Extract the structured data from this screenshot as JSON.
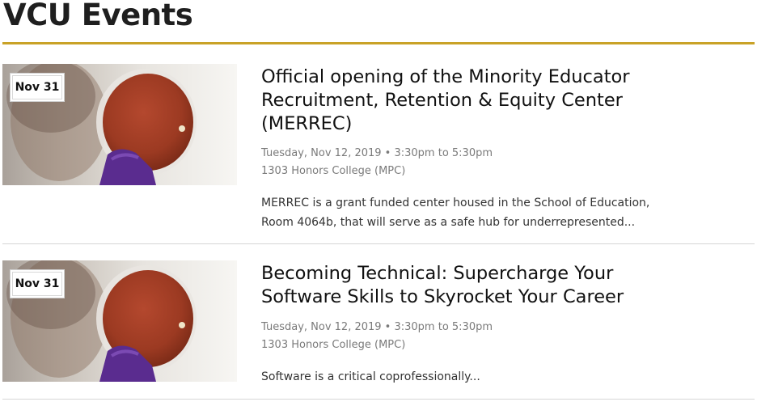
{
  "page": {
    "title": "VCU Events"
  },
  "colors": {
    "accent_rule": "#c9a227",
    "divider": "#d6d6d6",
    "meta_text": "#7a7a7a"
  },
  "events": [
    {
      "date_badge": "Nov 31",
      "title": "Official opening of the Minority Educator Recruitment, Retention & Equity Center (MERREC)",
      "datetime": "Tuesday, Nov 12, 2019 • 3:30pm to 5:30pm",
      "location": "1303 Honors College (MPC)",
      "description": "MERREC is a grant funded center housed in the School of Education, Room 4064b, that will serve as a safe hub for underrepresented...",
      "image_icon": "petri-dish-photo-icon"
    },
    {
      "date_badge": "Nov 31",
      "title": "Becoming Technical: Supercharge Your Software Skills to Skyrocket Your Career",
      "datetime": "Tuesday, Nov 12, 2019 • 3:30pm to 5:30pm",
      "location": "1303 Honors College (MPC)",
      "description": "Software is a critical coprofessionally...",
      "image_icon": "petri-dish-photo-icon"
    }
  ]
}
